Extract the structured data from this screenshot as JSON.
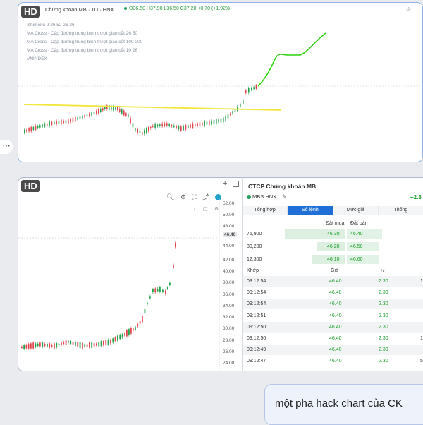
{
  "overlay": {
    "hd": "HD"
  },
  "top_chart": {
    "title": "Chứng khoán MB · 1D · HNX",
    "ohlc": "O36.50 H37.90 L36.50 C37.20 +0.70 (+1.92%)",
    "indicators": [
      "Ichimoku 9 26 52 26 26",
      "MA Cross - Cập đường trung bình trượt giao cắt 26 50",
      "MA Cross - Cập đường trung bình trượt giao cắt 100 200",
      "MA Cross - Cập đường trung bình trượt giao cắt 10 26",
      "VNINDEX"
    ],
    "line_colors": {
      "support": "#f2e63a",
      "projection": "#2fd30f",
      "up": "#22a24a",
      "down": "#e0464e"
    }
  },
  "bottom_chart": {
    "y_ticks": [
      "52.00",
      "50.00",
      "48.00",
      "46.40",
      "44.00",
      "42.00",
      "40.00",
      "38.00",
      "36.00",
      "34.00",
      "32.00",
      "30.00",
      "28.00",
      "26.00",
      "24.00"
    ],
    "current_price": "46.40"
  },
  "quote": {
    "title": "CTCP Chứng khoán MB",
    "symbol": "MBS:HNX",
    "change": "+2.3",
    "tabs": [
      "Tổng hợp",
      "Sổ lệnh",
      "Mức giá",
      "Thống"
    ],
    "active_tab": 1,
    "book_headers": [
      "Đặt mua",
      "Đặt bán"
    ],
    "book": [
      {
        "vol": "75,900",
        "bid": "46.30",
        "ask": "46.40"
      },
      {
        "vol": "30,200",
        "bid": "46.20",
        "ask": "46.50"
      },
      {
        "vol": "12,300",
        "bid": "46.10",
        "ask": "46.60"
      }
    ],
    "trade_headers": [
      "Khớp",
      "Giá",
      "+/-"
    ],
    "trades": [
      {
        "time": "09:12:54",
        "price": "46.40",
        "chg": "2.30",
        "extra": "1"
      },
      {
        "time": "09:12:54",
        "price": "46.40",
        "chg": "2.30",
        "extra": ""
      },
      {
        "time": "09:12:54",
        "price": "46.40",
        "chg": "2.30",
        "extra": ""
      },
      {
        "time": "09:12:51",
        "price": "46.40",
        "chg": "2.30",
        "extra": ""
      },
      {
        "time": "09:12:50",
        "price": "46.40",
        "chg": "2.30",
        "extra": ""
      },
      {
        "time": "09:12:50",
        "price": "46.40",
        "chg": "2.30",
        "extra": "1"
      },
      {
        "time": "09:12:49",
        "price": "46.40",
        "chg": "2.30",
        "extra": ""
      },
      {
        "time": "09:12:47",
        "price": "46.40",
        "chg": "2.30",
        "extra": "5"
      }
    ]
  },
  "chat": {
    "text": "một pha hack chart của CK"
  },
  "side": {
    "dots": "⋯"
  }
}
